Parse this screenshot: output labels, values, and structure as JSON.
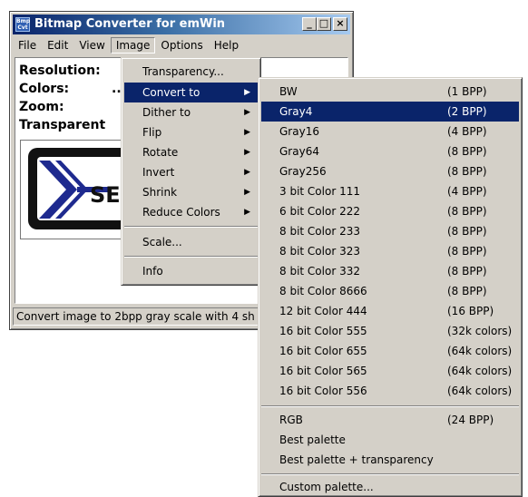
{
  "window": {
    "title": "Bitmap Converter for emWin",
    "icon_text": "Bmp Cvt",
    "controls": {
      "minimize": "_",
      "maximize": "□",
      "close": "×"
    }
  },
  "menubar": {
    "items": [
      "File",
      "Edit",
      "View",
      "Image",
      "Options",
      "Help"
    ],
    "active": "Image"
  },
  "info": {
    "resolution_label": "Resolution:",
    "colors_label": "Colors:",
    "colors_value": "..",
    "zoom_label": "Zoom:",
    "transparent_label": "Transparent"
  },
  "bitmap": {
    "logo_text": "SE"
  },
  "status": {
    "text": "Convert image to 2bpp gray scale with 4 sh"
  },
  "image_menu": {
    "items": [
      {
        "label": "Transparency...",
        "submenu": false
      },
      {
        "label": "Convert to",
        "submenu": true,
        "highlighted": true
      },
      {
        "label": "Dither to",
        "submenu": true
      },
      {
        "label": "Flip",
        "submenu": true
      },
      {
        "label": "Rotate",
        "submenu": true
      },
      {
        "label": "Invert",
        "submenu": true
      },
      {
        "label": "Shrink",
        "submenu": true
      },
      {
        "label": "Reduce Colors",
        "submenu": true
      },
      {
        "label": "Scale...",
        "submenu": false
      },
      {
        "label": "Info",
        "submenu": false
      }
    ],
    "submenu_arrow": "▶"
  },
  "convert_menu": {
    "items": [
      {
        "label": "BW",
        "bpp": "(1 BPP)"
      },
      {
        "label": "Gray4",
        "bpp": "(2 BPP)",
        "highlighted": true
      },
      {
        "label": "Gray16",
        "bpp": "(4 BPP)"
      },
      {
        "label": "Gray64",
        "bpp": "(8 BPP)"
      },
      {
        "label": "Gray256",
        "bpp": "(8 BPP)"
      },
      {
        "label": "3 bit Color 111",
        "bpp": "(4 BPP)"
      },
      {
        "label": "6 bit Color 222",
        "bpp": "(8 BPP)"
      },
      {
        "label": "8 bit Color 233",
        "bpp": "(8 BPP)"
      },
      {
        "label": "8 bit Color 323",
        "bpp": "(8 BPP)"
      },
      {
        "label": "8 bit Color 332",
        "bpp": "(8 BPP)"
      },
      {
        "label": "8 bit Color 8666",
        "bpp": "(8 BPP)"
      },
      {
        "label": "12 bit Color 444",
        "bpp": "(16 BPP)"
      },
      {
        "label": "16 bit Color 555",
        "bpp": "(32k colors)"
      },
      {
        "label": "16 bit Color 655",
        "bpp": "(64k colors)"
      },
      {
        "label": "16 bit Color 565",
        "bpp": "(64k colors)"
      },
      {
        "label": "16 bit Color 556",
        "bpp": "(64k colors)"
      },
      {
        "label": "RGB",
        "bpp": "(24 BPP)"
      },
      {
        "label": "Best palette",
        "bpp": ""
      },
      {
        "label": "Best palette + transparency",
        "bpp": ""
      },
      {
        "label": "Custom palette...",
        "bpp": ""
      }
    ]
  },
  "colors": {
    "highlight": "#0a246a",
    "face": "#d4d0c8",
    "logo_blue": "#1e2a8f"
  }
}
